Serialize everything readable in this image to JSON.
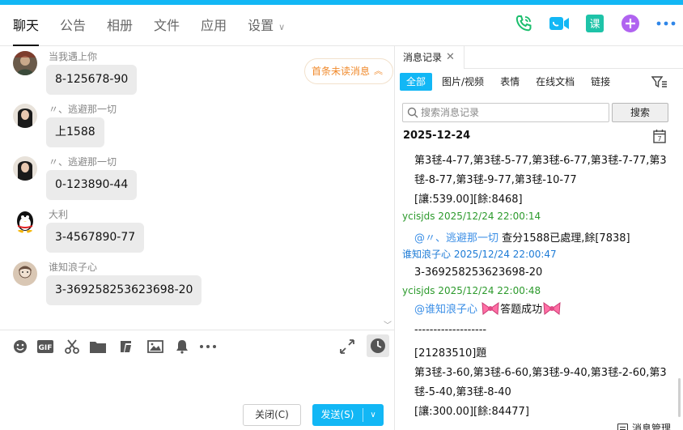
{
  "header": {
    "tabs": [
      {
        "label": "聊天",
        "active": true
      },
      {
        "label": "公告"
      },
      {
        "label": "相册"
      },
      {
        "label": "文件"
      },
      {
        "label": "应用"
      },
      {
        "label": "设置"
      }
    ],
    "icons": [
      "phone-icon",
      "video-call-icon",
      "lesson-icon",
      "add-app-icon",
      "more-icon"
    ],
    "lesson_label": "课",
    "accent": "#12b7f5"
  },
  "chat": {
    "messages": [
      {
        "sender": "当我遇上你",
        "text": "8-125678-90"
      },
      {
        "sender": "〃、逃避那一切",
        "text": "上1588"
      },
      {
        "sender": "〃、逃避那一切",
        "text": "0-123890-44"
      },
      {
        "sender": "大利",
        "text": "3-4567890-77"
      },
      {
        "sender": "谁知浪子心",
        "text": "3-369258253623698-20"
      }
    ],
    "unread_pill": "首条未读消息"
  },
  "toolbar": {
    "gif_label": "GIF",
    "close_label": "关闭(C)",
    "send_label": "发送(S)"
  },
  "history": {
    "tab_label": "消息记录",
    "filters": [
      "全部",
      "图片/视频",
      "表情",
      "在线文档",
      "链接"
    ],
    "search_placeholder": "搜索消息记录",
    "search_button": "搜索",
    "date": "2025-12-24",
    "calendar_day": "7",
    "lines": [
      {
        "kind": "body",
        "text": "第3毬-4-77,第3毬-5-77,第3毬-6-77,第3毬-7-77,第3"
      },
      {
        "kind": "body",
        "text": "毬-8-77,第3毬-9-77,第3毬-10-77"
      },
      {
        "kind": "body",
        "text": "[讓:539.00][餘:8468]"
      },
      {
        "kind": "meta-green",
        "text": "ycisjds 2025/12/24 22:00:14"
      },
      {
        "kind": "mention",
        "mention": "@〃、逃避那一切",
        "text": " 查分1588已處理,餘[7838]"
      },
      {
        "kind": "meta-blue",
        "text": "谁知浪子心 2025/12/24 22:00:47"
      },
      {
        "kind": "body",
        "text": "3-369258253623698-20"
      },
      {
        "kind": "meta-green",
        "text": "ycisjds 2025/12/24 22:00:48"
      },
      {
        "kind": "mention-bow",
        "mention": "@谁知浪子心",
        "text": "答题成功"
      },
      {
        "kind": "body",
        "text": "-------------------"
      },
      {
        "kind": "body",
        "text": "[21283510]題"
      },
      {
        "kind": "body",
        "text": "第3毬-3-60,第3毬-6-60,第3毬-9-40,第3毬-2-60,第3"
      },
      {
        "kind": "body",
        "text": "毬-5-40,第3毬-8-40"
      },
      {
        "kind": "body",
        "text": "[讓:300.00][餘:84477]"
      }
    ],
    "manage_label": "消息管理"
  }
}
